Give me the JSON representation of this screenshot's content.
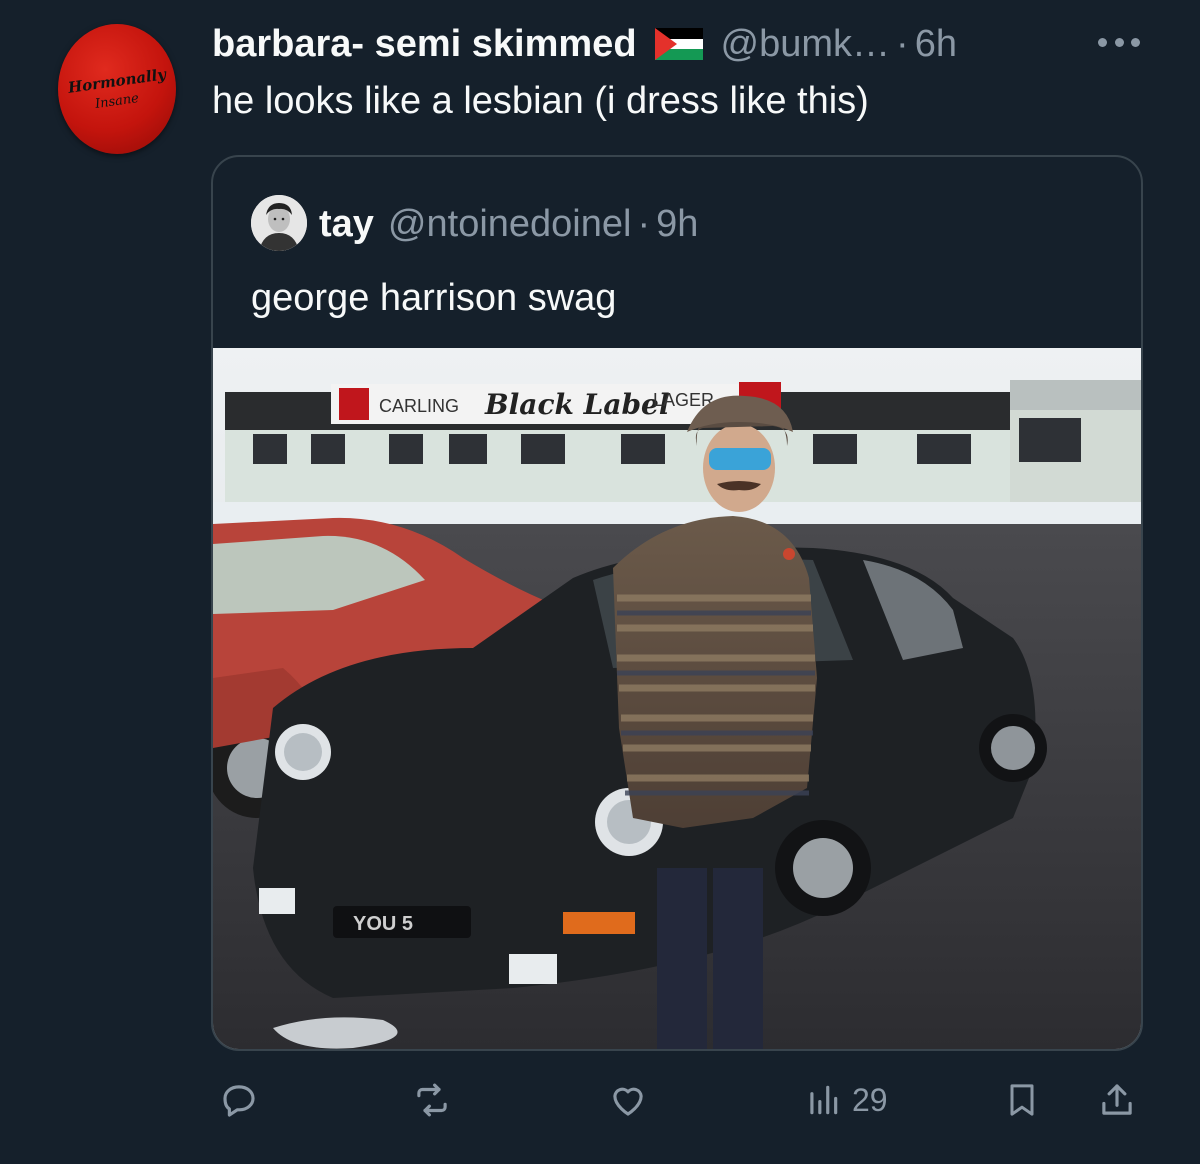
{
  "tweet": {
    "author": {
      "display_name": "barbara- semi skimmed",
      "handle": "@bumk…",
      "time": "6h",
      "avatar_line1": "Hormonally",
      "avatar_line2": "Insane"
    },
    "dot": "·",
    "text": "he looks like a lesbian (i dress like this)",
    "quote": {
      "display_name": "tay",
      "handle": "@ntoinedoinel",
      "time": "9h",
      "text": "george harrison swag",
      "photo": {
        "sign_left": "CARLING",
        "sign_brand": "Black Label",
        "sign_right": "LAGER",
        "plate": "YOU 5"
      }
    },
    "actions": {
      "views": "29"
    }
  },
  "colors": {
    "background": "#15202b",
    "text_primary": "#f7f9f9",
    "text_secondary": "#8b98a5",
    "border": "#38444d"
  }
}
